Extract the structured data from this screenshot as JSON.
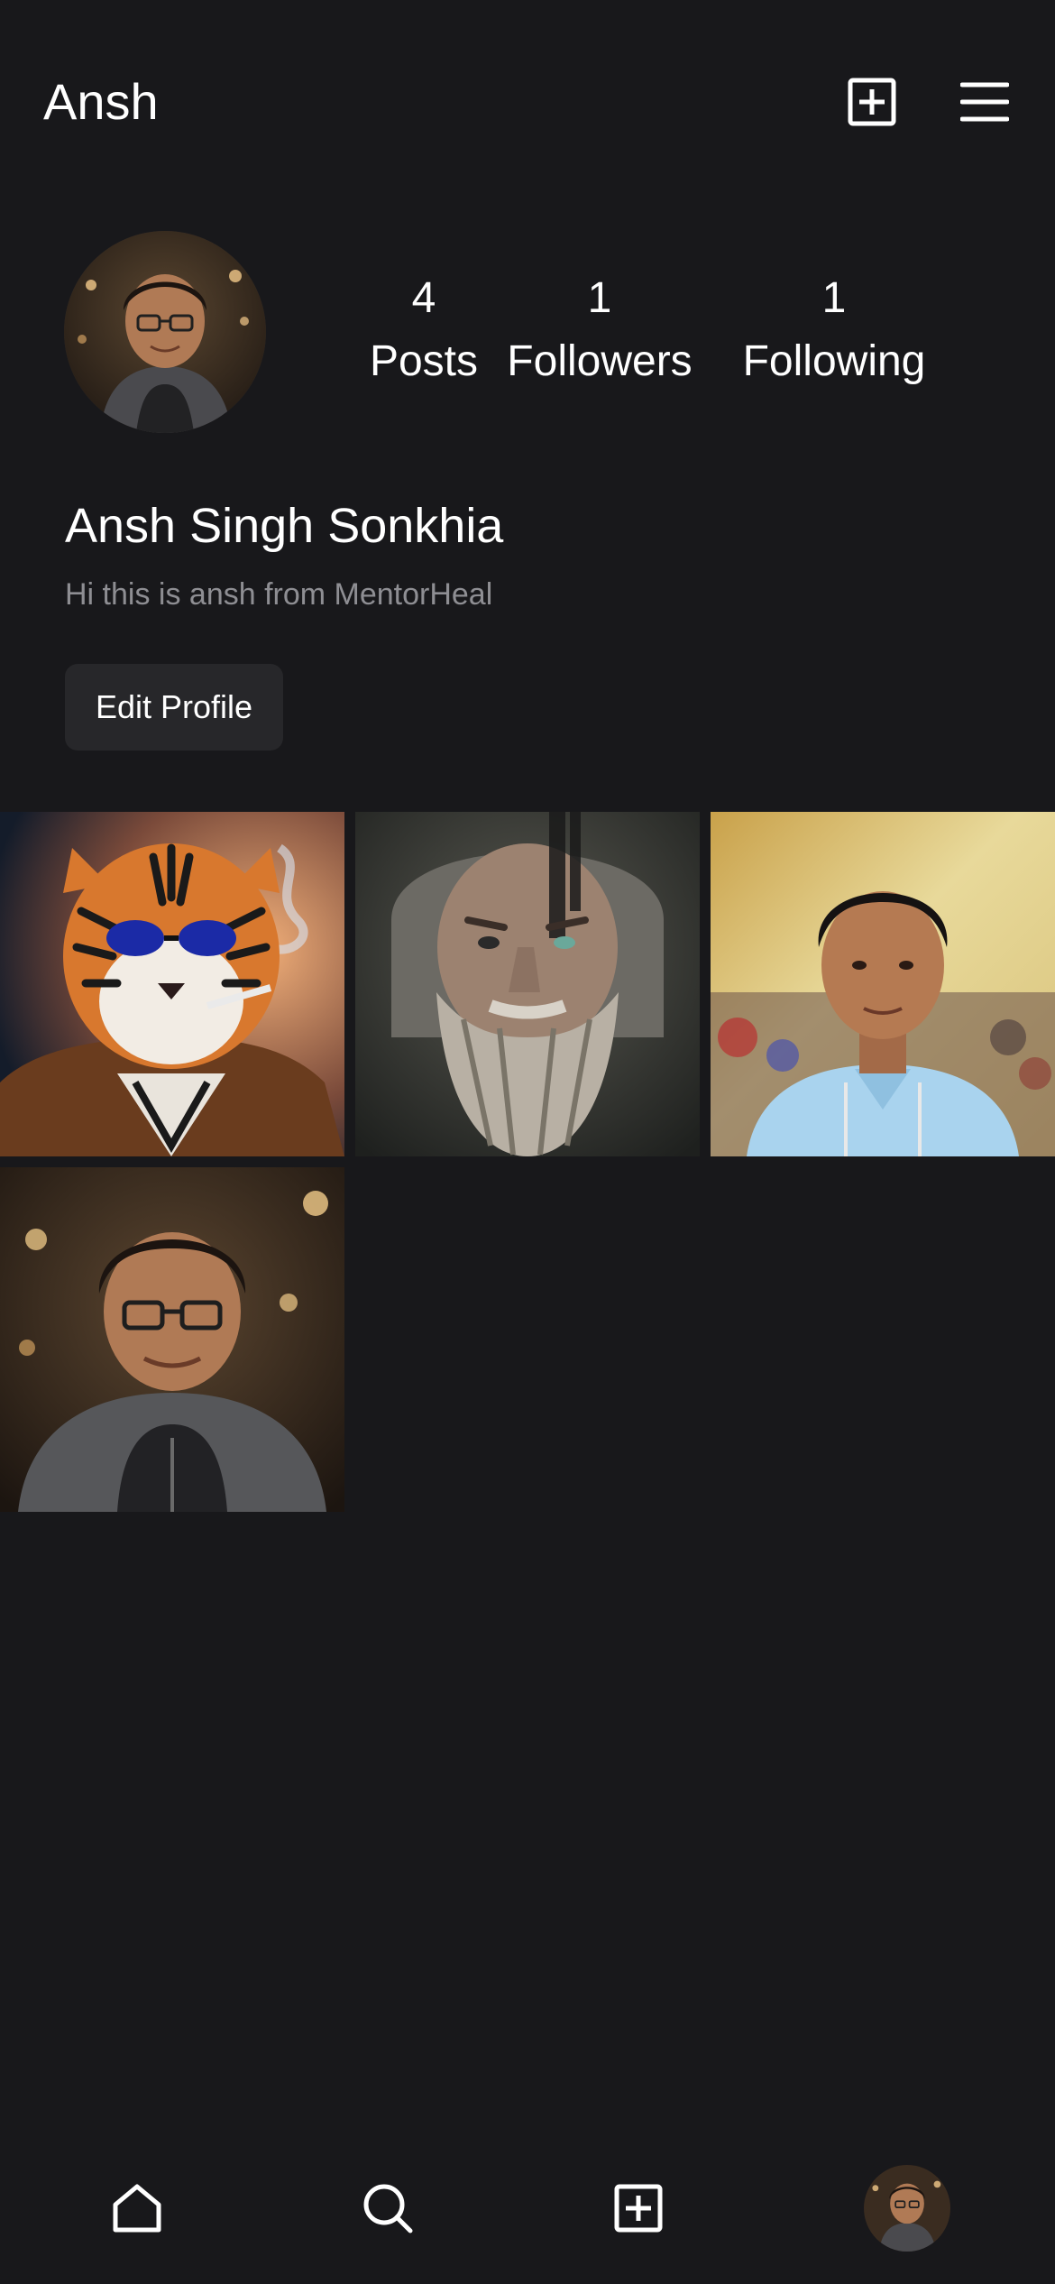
{
  "header": {
    "title": "Ansh",
    "add_icon": "plus-square-icon",
    "menu_icon": "hamburger-menu-icon"
  },
  "profile": {
    "avatar": "profile-photo",
    "stats": {
      "posts_count": "4",
      "posts_label": "Posts",
      "followers_count": "1",
      "followers_label": "Followers",
      "following_count": "1",
      "following_label": "Following"
    },
    "full_name": "Ansh Singh Sonkhia",
    "bio": "Hi this is ansh from MentorHeal",
    "edit_button_label": "Edit Profile"
  },
  "posts": [
    {
      "subject": "tiger-with-sunglasses"
    },
    {
      "subject": "bearded-old-warrior"
    },
    {
      "subject": "man-in-light-blue-shirt"
    },
    {
      "subject": "man-with-glasses-portrait"
    }
  ],
  "bottom_nav": {
    "items": [
      {
        "icon": "home-icon"
      },
      {
        "icon": "search-icon"
      },
      {
        "icon": "plus-square-icon"
      },
      {
        "icon": "profile-avatar"
      }
    ]
  },
  "colors": {
    "background": "#18181b",
    "button_bg": "#27272a",
    "secondary_text": "#8e8e93",
    "primary_text": "#ffffff"
  }
}
